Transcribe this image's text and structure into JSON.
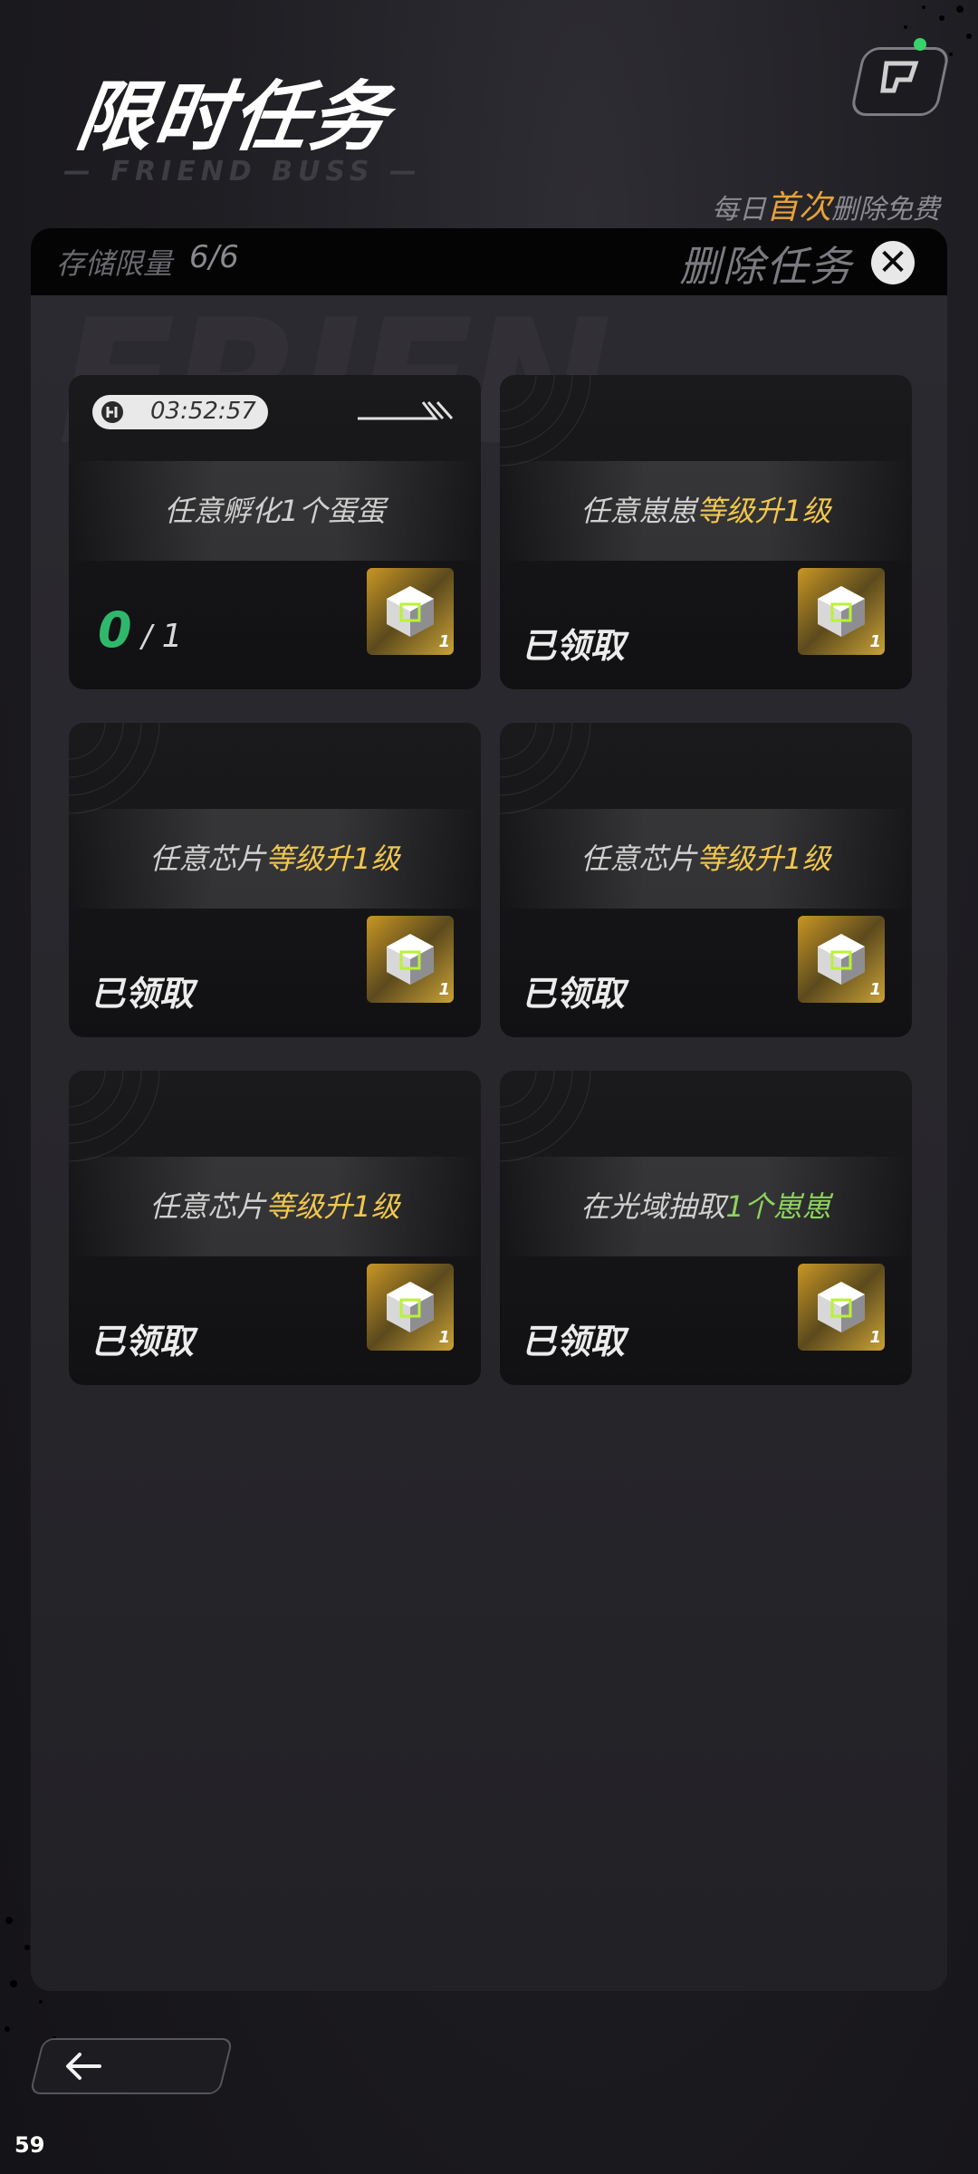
{
  "header": {
    "title": "限时任务",
    "subtitle": "— FRIEND BUSS —",
    "quest_icon": "quest-scroll-icon",
    "free_note_prefix": "每日",
    "free_note_highlight": "首次",
    "free_note_suffix": "删除免费"
  },
  "storage_bar": {
    "capacity_label": "存储限量",
    "capacity_value": "6/6",
    "delete_label": "删除任务",
    "delete_icon": "close-icon"
  },
  "cards": [
    {
      "timer": "03:52:57",
      "task_prefix": "任意孵化1个蛋蛋",
      "task_highlight": "",
      "progress_done": "0",
      "progress_total": "1",
      "claimed_label": "",
      "reward_count": "1"
    },
    {
      "task_prefix": "任意崽崽",
      "task_highlight": "等级升1级",
      "claimed_label": "已领取",
      "reward_count": "1"
    },
    {
      "task_prefix": "任意芯片",
      "task_highlight": "等级升1级",
      "claimed_label": "已领取",
      "reward_count": "1"
    },
    {
      "task_prefix": "任意芯片",
      "task_highlight": "等级升1级",
      "claimed_label": "已领取",
      "reward_count": "1"
    },
    {
      "task_prefix": "任意芯片",
      "task_highlight": "等级升1级",
      "claimed_label": "已领取",
      "reward_count": "1"
    },
    {
      "task_prefix": "在光域抽取",
      "task_highlight": "1个崽崽",
      "claimed_label": "已领取",
      "reward_count": "1"
    }
  ],
  "colors": {
    "highlight_yellow": "#f0c64e",
    "highlight_green": "#8ed25f",
    "progress_green": "#2fb86b",
    "free_orange": "#e7a23a"
  },
  "footer": {
    "back_icon": "back-arrow-icon",
    "fps": "59"
  }
}
